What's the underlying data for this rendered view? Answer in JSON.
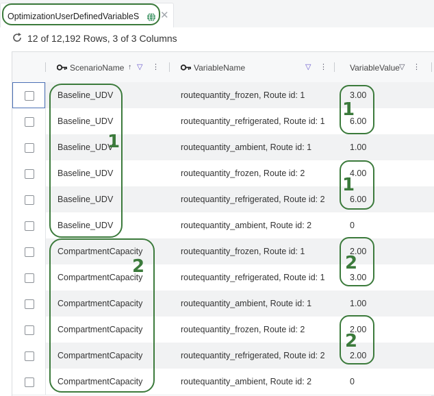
{
  "tab": {
    "title": "OptimizationUserDefinedVariableS"
  },
  "toolbar": {
    "row_count": "12 of 12,192 Rows, 3 of 3 Columns"
  },
  "columns": [
    {
      "label": "ScenarioName"
    },
    {
      "label": "VariableName"
    },
    {
      "label": "VariableValue"
    }
  ],
  "rows": [
    {
      "scenario": "Baseline_UDV",
      "variable": "routequantity_frozen, Route id: 1",
      "value": "3.00"
    },
    {
      "scenario": "Baseline_UDV",
      "variable": "routequantity_refrigerated, Route id: 1",
      "value": "6.00"
    },
    {
      "scenario": "Baseline_UDV",
      "variable": "routequantity_ambient, Route id: 1",
      "value": "1.00"
    },
    {
      "scenario": "Baseline_UDV",
      "variable": "routequantity_frozen, Route id: 2",
      "value": "4.00"
    },
    {
      "scenario": "Baseline_UDV",
      "variable": "routequantity_refrigerated, Route id: 2",
      "value": "6.00"
    },
    {
      "scenario": "Baseline_UDV",
      "variable": "routequantity_ambient, Route id: 2",
      "value": "0"
    },
    {
      "scenario": "CompartmentCapacity",
      "variable": "routequantity_frozen, Route id: 1",
      "value": "2.00"
    },
    {
      "scenario": "CompartmentCapacity",
      "variable": "routequantity_refrigerated, Route id: 1",
      "value": "3.00"
    },
    {
      "scenario": "CompartmentCapacity",
      "variable": "routequantity_ambient, Route id: 1",
      "value": "1.00"
    },
    {
      "scenario": "CompartmentCapacity",
      "variable": "routequantity_frozen, Route id: 2",
      "value": "2.00"
    },
    {
      "scenario": "CompartmentCapacity",
      "variable": "routequantity_refrigerated, Route id: 2",
      "value": "2.00"
    },
    {
      "scenario": "CompartmentCapacity",
      "variable": "routequantity_ambient, Route id: 2",
      "value": "0"
    }
  ],
  "annotations": {
    "group_a": "1",
    "group_b": "2",
    "pair_a1": "1",
    "pair_a2": "1",
    "pair_b1": "2",
    "pair_b2": "2",
    "color": "#3b7a3b"
  },
  "icons": {
    "tab": [
      "globe-icon",
      "close-icon"
    ],
    "toolbar": [
      "refresh-icon"
    ],
    "header": [
      "key-icon",
      "sort-up-icon",
      "filter-icon",
      "column-menu-icon"
    ]
  }
}
